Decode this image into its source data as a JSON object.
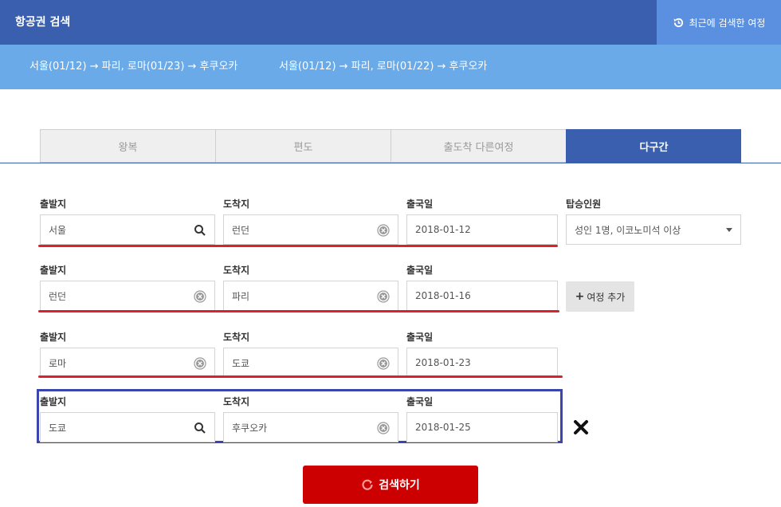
{
  "header": {
    "title": "항공권 검색",
    "recent_label": "최근에 검색한 여정"
  },
  "history": [
    "서울(01/12) → 파리, 로마(01/23) → 후쿠오카",
    "서울(01/12) → 파리, 로마(01/22) → 후쿠오카"
  ],
  "tabs": [
    {
      "label": "왕복",
      "active": false
    },
    {
      "label": "편도",
      "active": false
    },
    {
      "label": "출도착 다른여정",
      "active": false
    },
    {
      "label": "다구간",
      "active": true
    }
  ],
  "labels": {
    "origin": "출발지",
    "destination": "도착지",
    "date": "출국일",
    "passengers": "탑승인원"
  },
  "legs": [
    {
      "origin": "서울",
      "origin_icon": "search-icon",
      "destination": "런던",
      "destination_icon": "clear-icon",
      "date": "2018-01-12"
    },
    {
      "origin": "런던",
      "origin_icon": "clear-icon",
      "destination": "파리",
      "destination_icon": "clear-icon",
      "date": "2018-01-16"
    },
    {
      "origin": "로마",
      "origin_icon": "clear-icon",
      "destination": "도쿄",
      "destination_icon": "clear-icon",
      "date": "2018-01-23"
    },
    {
      "origin": "도쿄",
      "origin_icon": "search-icon",
      "destination": "후쿠오카",
      "destination_icon": "clear-icon",
      "date": "2018-01-25"
    }
  ],
  "passengers": {
    "value": "성인 1명, 이코노미석 이상"
  },
  "add_leg_label": "여정 추가",
  "search_label": "검색하기",
  "colors": {
    "primary": "#3a5fae",
    "accent_red": "#cc0000",
    "history_bar": "#6aaae8",
    "annotation_red": "#d9232b",
    "annotation_blue": "#3a45b0"
  }
}
